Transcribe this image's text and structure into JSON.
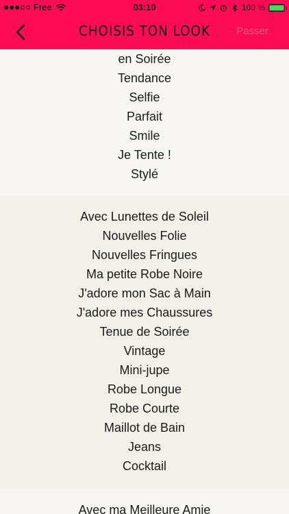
{
  "status_bar": {
    "carrier": "Free",
    "time": "03:10",
    "battery_text": "100 %",
    "battery_level": 1.0,
    "signal_bars_filled": 3,
    "signal_bars_total": 5,
    "icons": [
      "wifi-icon",
      "moon-icon",
      "location-icon",
      "alarm-icon",
      "bluetooth-icon",
      "battery-icon"
    ],
    "battery_color": "#4cd964"
  },
  "nav": {
    "title": "CHOISIS TON LOOK",
    "skip_label": "Passer",
    "back_icon": "chevron-left-icon",
    "bar_color": "#fd0c55",
    "skip_color": "#d85b7c"
  },
  "sections": [
    {
      "items": [
        "en Soirée",
        "Tendance",
        "Selfie",
        "Parfait",
        "Smile",
        "Je Tente !",
        "Stylé"
      ]
    },
    {
      "items": [
        "Avec Lunettes de Soleil",
        "Nouvelles Folie",
        "Nouvelles Fringues",
        "Ma petite Robe Noire",
        "J'adore mon Sac à Main",
        "J'adore mes Chaussures",
        "Tenue de Soirée",
        "Vintage",
        "Mini-jupe",
        "Robe Longue",
        "Robe Courte",
        "Maillot de Bain",
        "Jeans",
        "Cocktail"
      ]
    },
    {
      "items": [
        "Avec ma Meilleure Amie"
      ]
    }
  ]
}
